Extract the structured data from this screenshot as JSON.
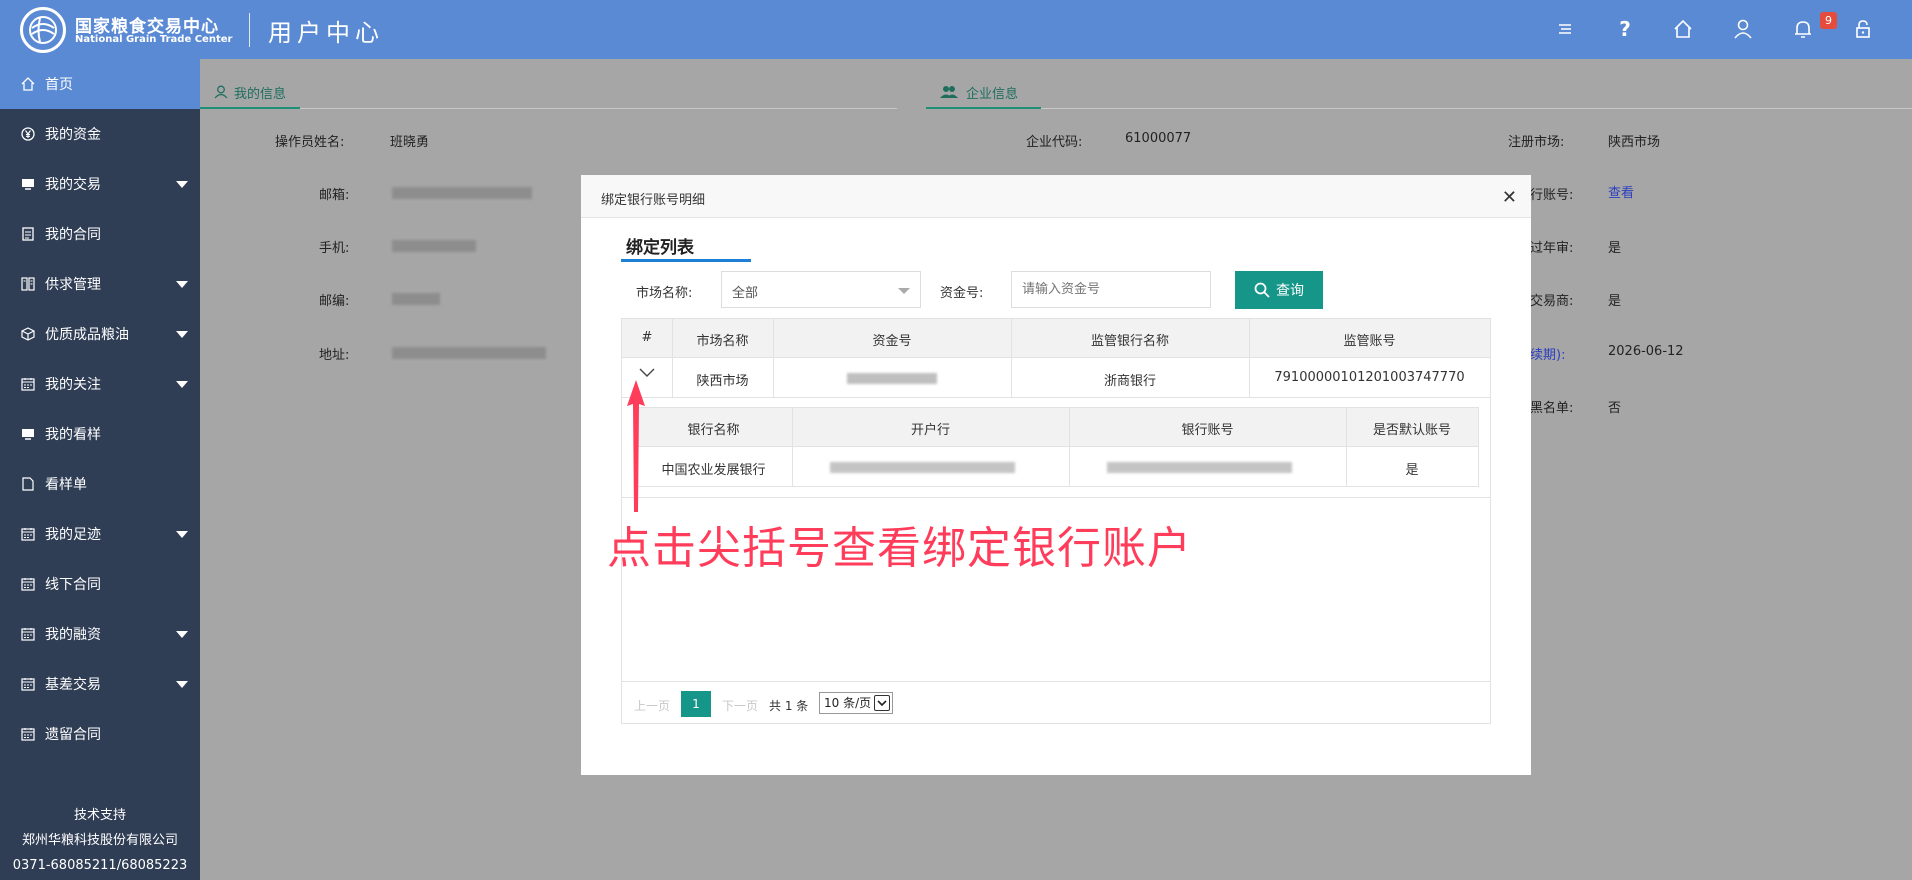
{
  "header": {
    "brand_cn": "国家粮食交易中心",
    "brand_en": "National Grain Trade Center",
    "subtitle": "用户中心",
    "notification_count": "9",
    "bg_color": "#5b8ad4"
  },
  "sidebar": {
    "items": [
      {
        "label": "首页",
        "icon": "home-icon"
      },
      {
        "label": "我的资金",
        "icon": "yen-icon"
      },
      {
        "label": "我的交易",
        "icon": "trade-icon"
      },
      {
        "label": "我的合同",
        "icon": "contract-icon"
      },
      {
        "label": "供求管理",
        "icon": "supply-icon"
      },
      {
        "label": "优质成品粮油",
        "icon": "cube-icon"
      },
      {
        "label": "我的关注",
        "icon": "calendar-icon"
      },
      {
        "label": "我的看样",
        "icon": "sample-icon"
      },
      {
        "label": "看样单",
        "icon": "doc-icon"
      },
      {
        "label": "我的足迹",
        "icon": "calendar-icon"
      },
      {
        "label": "线下合同",
        "icon": "calendar-icon"
      },
      {
        "label": "我的融资",
        "icon": "calendar-icon"
      },
      {
        "label": "基差交易",
        "icon": "calendar-icon"
      },
      {
        "label": "遗留合同",
        "icon": "calendar-icon"
      }
    ],
    "footer": [
      "技术支持",
      "郑州华粮科技股份有限公司",
      "0371-68085211/68085223"
    ]
  },
  "tabs": {
    "my_info": "我的信息",
    "company_info": "企业信息"
  },
  "my_info": {
    "operator_label": "操作员姓名:",
    "operator_value": "班晓勇",
    "email_label": "邮箱:",
    "phone_label": "手机:",
    "postcode_label": "邮编:",
    "address_label": "地址:"
  },
  "company_info": {
    "code_label": "企业代码:",
    "code_value": "61000077",
    "market_label": "注册市场:",
    "market_value": "陕西市场",
    "account_label_partial": "行账号:",
    "account_link": "查看",
    "annual_label_partial": "过年审:",
    "annual_value": "是",
    "trader_label_partial": "交易商:",
    "trader_value": "是",
    "expire_label_partial": "续期):",
    "expire_value": "2026-06-12",
    "blacklist_label_partial": "黑名单:",
    "blacklist_value": "否"
  },
  "modal": {
    "title": "绑定银行账号明细",
    "list_title": "绑定列表",
    "market_label": "市场名称:",
    "market_select": "全部",
    "fund_label": "资金号:",
    "fund_placeholder": "请输入资金号",
    "query_button": "查询",
    "table_headers": [
      "#",
      "市场名称",
      "资金号",
      "监管银行名称",
      "监管账号"
    ],
    "rows": [
      {
        "market": "陕西市场",
        "bank": "浙商银行",
        "account": "79100000101201003747770"
      }
    ],
    "sub_headers": [
      "银行名称",
      "开户行",
      "银行账号",
      "是否默认账号"
    ],
    "sub_rows": [
      {
        "bank_name": "中国农业发展银行",
        "is_default": "是"
      }
    ],
    "pagination": {
      "prev": "上一页",
      "current": "1",
      "next": "下一页",
      "total": "共 1 条",
      "page_size": "10 条/页"
    }
  },
  "annotation": "点击尖括号查看绑定银行账户",
  "colors": {
    "accent_teal": "#159688",
    "sidebar_bg": "#2f3d55",
    "annotation": "#ff3d5a"
  }
}
